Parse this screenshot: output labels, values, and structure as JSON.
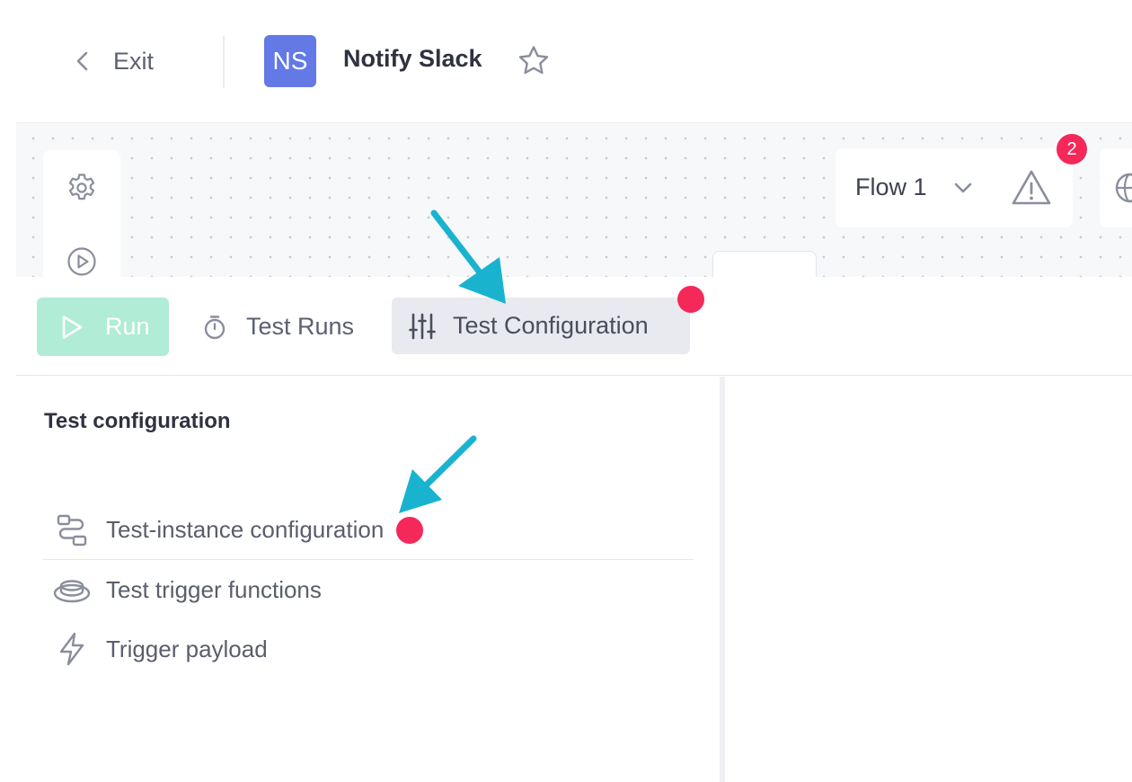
{
  "header": {
    "exit_label": "Exit",
    "avatar_initials": "NS",
    "workflow_title": "Notify Slack",
    "star_icon": "star-outline-icon"
  },
  "canvas": {
    "sidebar_icons": [
      "gear-icon",
      "play-circle-icon"
    ],
    "flow_selector": {
      "label": "Flow 1",
      "icon": "chevron-down-icon"
    },
    "warnings_icon": "warning-triangle-icon",
    "warnings_count": "2",
    "right_icon": "globe-icon"
  },
  "toolbar": {
    "run_label": "Run",
    "test_runs_label": "Test Runs",
    "test_configuration_label": "Test Configuration",
    "test_configuration_has_alert": true
  },
  "test_config_panel": {
    "title": "Test configuration",
    "items": [
      {
        "label": "Test-instance configuration",
        "icon": "flow-nodes-icon",
        "has_alert": true
      },
      {
        "label": "Test trigger functions",
        "icon": "button-stack-icon",
        "has_alert": false
      },
      {
        "label": "Trigger payload",
        "icon": "lightning-icon",
        "has_alert": false
      }
    ]
  },
  "colors": {
    "accent_avatar": "#6279e6",
    "alert_red": "#f5285a",
    "run_button_disabled": "#b0ecd6",
    "annotation_arrow": "#1ab3cf"
  }
}
